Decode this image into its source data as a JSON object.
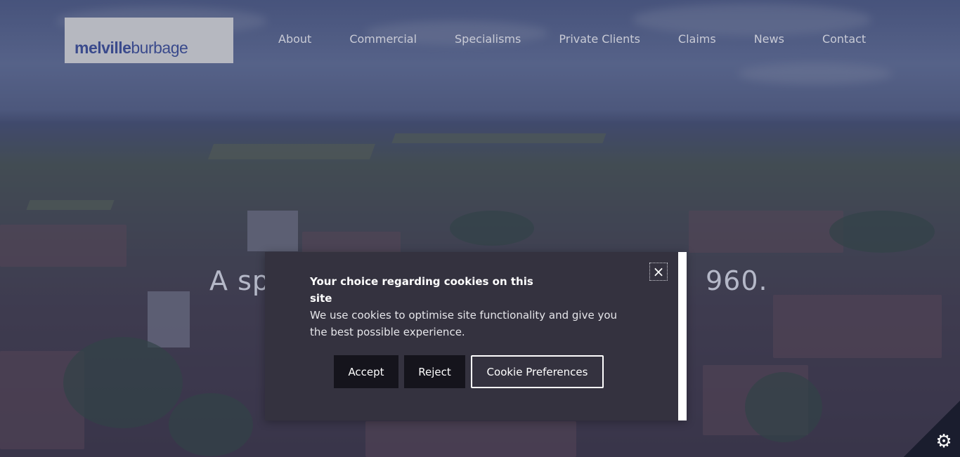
{
  "header": {
    "logo": {
      "bold": "melville",
      "regular": "burbage"
    },
    "nav": [
      {
        "label": "About"
      },
      {
        "label": "Commercial"
      },
      {
        "label": "Specialisms"
      },
      {
        "label": "Private Clients"
      },
      {
        "label": "Claims"
      },
      {
        "label": "News"
      },
      {
        "label": "Contact"
      }
    ]
  },
  "hero": {
    "visible_left": "A sp",
    "visible_right": "960."
  },
  "cookie_modal": {
    "title": "Your choice regarding cookies on this site",
    "text": "We use cookies to optimise site functionality and give you the best possible experience.",
    "close_icon": "×",
    "buttons": {
      "accept": "Accept",
      "reject": "Reject",
      "preferences": "Cookie Preferences"
    }
  },
  "corner": {
    "icon": "gear-icon",
    "glyph": "⚙"
  },
  "colors": {
    "overlay": "#283058",
    "modal_bg": "#34323f",
    "button_dark": "#15141c",
    "logo_bg": "#b6b8c0",
    "logo_text": "#3a4a8c",
    "nav_text": "#c9cbd6"
  }
}
